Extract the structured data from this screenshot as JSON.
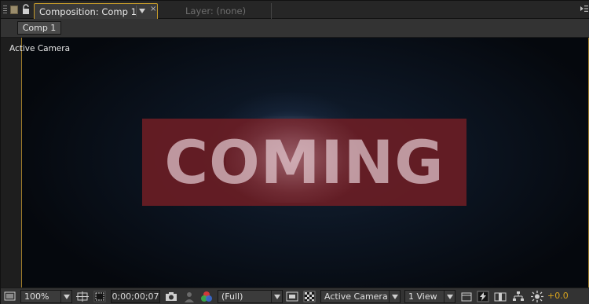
{
  "tabs": {
    "composition": {
      "label": "Composition: Comp 1",
      "close": "×"
    },
    "layer": {
      "label": "Layer: (none)"
    }
  },
  "breadcrumb": {
    "comp_label": "Comp 1"
  },
  "viewer": {
    "view_label": "Active Camera",
    "frame_text": "COMING"
  },
  "toolbar": {
    "zoom": "100%",
    "timecode": "0;00;00;07",
    "resolution": "(Full)",
    "camera": "Active Camera",
    "view_layout": "1 View",
    "exposure": "+0.0"
  },
  "colors": {
    "accent_gold": "#c49a2a",
    "plate_red": "#6e1e24",
    "exposure_text": "#d6a21e"
  },
  "icons": [
    "grip-icon",
    "lock-icon",
    "panel-menu-icon",
    "region-of-interest-icon",
    "transparency-grid-icon",
    "snapshot-icon",
    "show-snapshot-icon",
    "show-channel-icon",
    "fast-preview-icon",
    "toggle-pixel-aspect-icon",
    "flowchart-icon",
    "reset-exposure-icon"
  ]
}
